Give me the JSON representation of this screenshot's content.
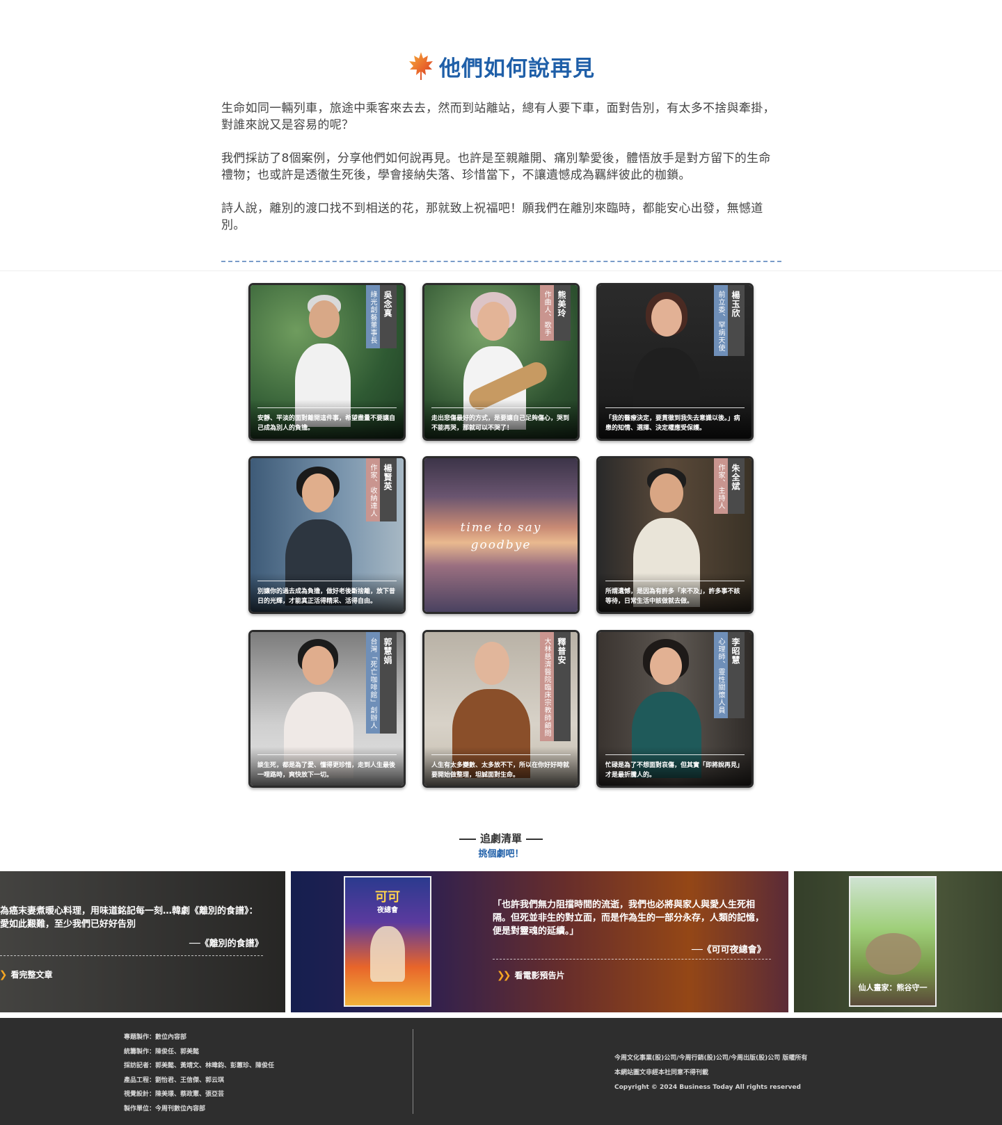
{
  "header": {
    "title": "他們如何說再見"
  },
  "intro": {
    "paragraphs": [
      "生命如同一輛列車，旅途中乘客來去去，然而到站離站，總有人要下車，面對告別，有太多不捨與牽掛，對誰來說又是容易的呢？",
      "我們採訪了8個案例，分享他們如何說再見。也許是至親離開、痛別摯愛後，體悟放手是對方留下的生命禮物；也或許是透徹生死後，學會接納失落、珍惜當下，不讓遺憾成為羈絆彼此的枷鎖。",
      "詩人說，離別的渡口找不到相送的花，那就致上祝福吧！願我們在離別來臨時，都能安心出發，無憾道別。"
    ]
  },
  "cards": [
    {
      "name": "吳念真",
      "title": "綠光創藝董事長",
      "caption": "安靜、平淡的面對離開這件事，希望盡量不要讓自己成為別人的負擔。",
      "tag_color": "#6f8fb8"
    },
    {
      "name": "熊美玲",
      "title": "作曲人、歌手",
      "caption": "走出悲傷最好的方式，是要讓自己足夠傷心，哭到不能再哭，那就可以不哭了！",
      "tag_color": "#c9958f"
    },
    {
      "name": "楊玉欣",
      "title": "前立委、罕病天使",
      "caption": "「我的醫療決定，要貫徹到我失去意識以後。」病患的知情、選擇、決定權應受保護。",
      "tag_color": "#6f8fb8"
    },
    {
      "name": "楊賢英",
      "title": "作家、收納達人",
      "caption": "別讓你的過去成為負擔，做好老後斷捨離，放下昔日的光輝，才能真正活得精采、活得自由。",
      "tag_color": "#c9958f"
    },
    {
      "name": "",
      "title": "",
      "caption": "",
      "tag_color": ""
    },
    {
      "name": "朱全斌",
      "title": "作家、主持人",
      "caption": "所謂遺憾，是因為有許多「來不及」，許多事不該等待，日常生活中該做就去做。",
      "tag_color": "#c9958f"
    },
    {
      "name": "郭慧娟",
      "title": "台灣「死亡咖啡館」創辦人",
      "caption": "談生死，都是為了愛、懂得更珍惜，走到人生最後一哩路時，爽快放下一切。",
      "tag_color": "#6f8fb8"
    },
    {
      "name": "釋普安",
      "title": "大林慈濟醫院臨床宗教師顧問",
      "caption": "人生有太多變數、太多放不下，所以在你好好時就要開始做整理，坦誠面對生命。",
      "tag_color": "#c9958f"
    },
    {
      "name": "李昭慧",
      "title": "心理師、靈性關懷人員",
      "caption": "忙碌是為了不想面對哀傷，但其實「即將說再見」才是最折騰人的。",
      "tag_color": "#6f8fb8"
    }
  ],
  "center_card": {
    "line1": "time to say",
    "line2": "goodbye"
  },
  "watchlist": {
    "title": "追劇清單",
    "subtitle": "挑個劇吧！",
    "slides": [
      {
        "quote_line1": "為癌末妻煮暖心料理，用味道銘記每一刻…韓劇《離別的食譜》：",
        "quote_line2": "愛如此艱難，至少我們已好好告別",
        "source": "──《離別的食譜》",
        "link": "看完整文章"
      },
      {
        "quote_line1": "「也許我們無力阻擋時間的流逝，我們也必將與家人與愛人生死相",
        "quote_line2": "隔。但死並非生的對立面，而是作為生的一部分永存，人類的記憶，",
        "quote_line3": "便是對靈魂的延續。」",
        "source": "──《可可夜總會》",
        "link": "看電影預告片",
        "poster_title": "可可",
        "poster_sub": "夜總會"
      },
      {
        "poster_title": "仙人畫家：熊谷守一"
      }
    ]
  },
  "footer": {
    "credits": [
      "專題製作：數位內容部",
      "統籌製作：陳俊任、郭美懿",
      "採訪記者：郭美懿、黃靖文、林暐鈞、彭蕙珍、陳俊任",
      "產品工程：劉怡君、王信傑、郭云琪",
      "視覺設計：陳美璟、蔡政憲、張亞芸",
      "製作單位：今周刊數位內容部"
    ],
    "legal": [
      "今周文化事業(股)公司/今周行銷(股)公司/今周出版(股)公司 版權所有",
      "本網站圖文非經本社同意不得刊載",
      "Copyright © 2024 Business Today All rights reserved"
    ]
  }
}
